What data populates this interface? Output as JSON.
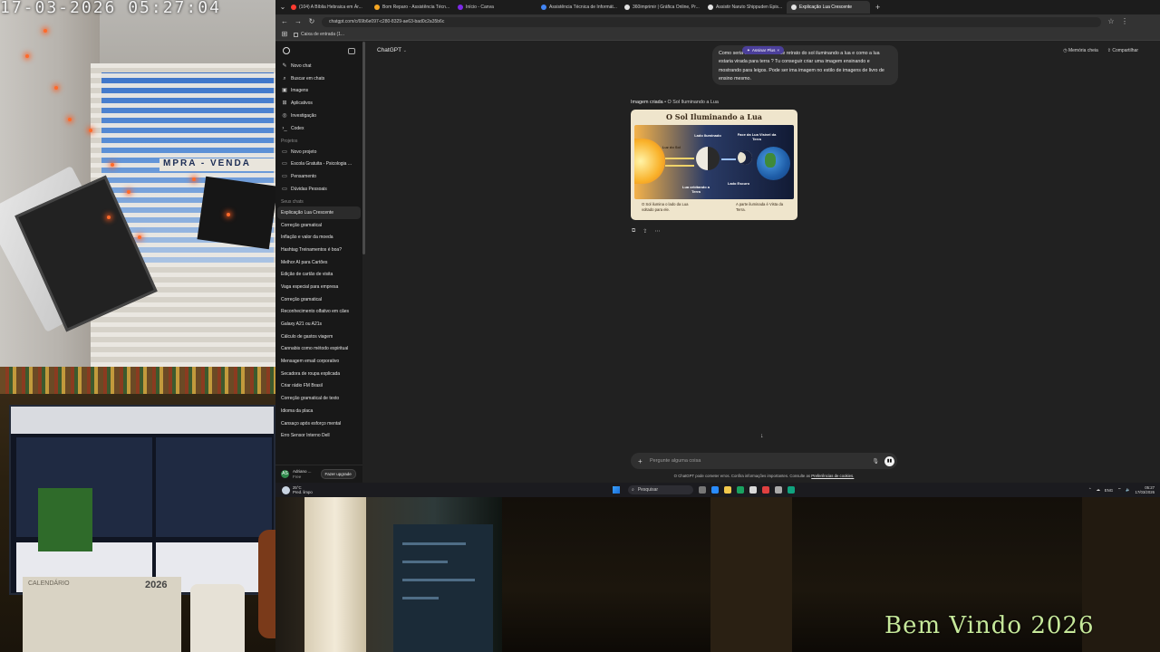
{
  "overlay": {
    "timestamp": "17-03-2026  05:27:04",
    "welcome": "Bem Vindo 2026",
    "sign_text": "MPRA - VENDA",
    "calendar_year": "2026",
    "calendar_label": "CALENDÁRIO"
  },
  "browser": {
    "tabs": [
      {
        "label": "(104) A Bíblia Hebraica em Ár...",
        "color": "#ff3b30"
      },
      {
        "label": "Bom Reparo - Assistência Técn...",
        "color": "#f5a623"
      },
      {
        "label": "Início - Canva",
        "color": "#7d2ae8"
      },
      {
        "label": "Assistência Técnica de Informát...",
        "color": "#4285f4"
      },
      {
        "label": "360imprimir | Gráfica Online, Pr...",
        "color": "#e2e2e2"
      },
      {
        "label": "Assistir Naruto Shippuden Epis...",
        "color": "#e2e2e2"
      },
      {
        "label": "Explicação Lua Crescente",
        "color": "#e2e2e2"
      }
    ],
    "url": "chatgpt.com/c/69b6e097-c280-8329-ae63-bad0c2a35b6c",
    "bookmark": "Caixa de entrada (1..."
  },
  "sidebar": {
    "nav": [
      {
        "label": "Novo chat",
        "icon": "✎"
      },
      {
        "label": "Buscar em chats",
        "icon": "⌕"
      },
      {
        "label": "Imagens",
        "icon": "▣"
      },
      {
        "label": "Aplicativos",
        "icon": "⊞"
      },
      {
        "label": "Investigação",
        "icon": "◎"
      },
      {
        "label": "Codex",
        "icon": "›_"
      }
    ],
    "projects_title": "Projetos",
    "projects": [
      {
        "label": "Novo projeto",
        "icon": "▭"
      },
      {
        "label": "Escola Gratuita - Psicologia ...",
        "icon": "▭"
      },
      {
        "label": "Pensamento",
        "icon": "▭"
      },
      {
        "label": "Dúvidas Pessoais",
        "icon": "▭"
      }
    ],
    "chats_title": "Seus chats",
    "chats": [
      "Explicação Lua Crescente",
      "Correção gramatical",
      "Inflação e valor da moeda",
      "Hashtag Treinamentos é boa?",
      "Melhor AI para Cartões",
      "Edição de cartão de visita",
      "Vaga especial para empresa",
      "Correção gramatical",
      "Reconhecimento olfativo em cães",
      "Galaxy A21 ou A21s",
      "Cálculo de gastos viagem",
      "Cannabis como método espiritual",
      "Mensagem email corporativo",
      "Secadora de roupa explicada",
      "Criar rádio FM Brasil",
      "Correção gramatical de texto",
      "Idioma da placa",
      "Cansaço após esforço mental",
      "Erro Sensor Interno Dell"
    ],
    "user": {
      "name": "Adriano ...",
      "plan": "Free",
      "initials": "AS",
      "upgrade": "Fazer upgrade"
    }
  },
  "main": {
    "model": "ChatGPT",
    "header_memory": "Memória cheia",
    "header_share": "Compartilhar",
    "plus_pill": "Assinar Plus",
    "user_message": "Como seria um desenho desse retrato do sol iluminando a lua e como a lua estaria virada para terra ? Tu conseguir criar uma imagem ensinando e mostrando para leigos. Pode ser ima imagem no estilo de imagens de livro de ensino mesmo.",
    "image_label_prefix": "Imagem criada",
    "image_label_title": "O Sol Iluminando a Lua",
    "image": {
      "title": "O Sol Iluminando a Lua",
      "label_sun": "Luz do Sol",
      "label_lit": "Lado Iluminado",
      "label_face": "Face da Lua Visível da Terra",
      "label_dark": "Lado Escuro",
      "label_orbit": "Lua orbitando a Terra",
      "caption_left": "O Sol ilumina o lado da Lua voltado para ele.",
      "caption_right": "A parte iluminada é Vista da Terra."
    },
    "composer_placeholder": "Pergunte alguma coisa",
    "disclaimer": "O ChatGPT pode cometer erros. Confira informações importantes. Consulte as",
    "disclaimer_link": "Preferências de cookies."
  },
  "taskbar": {
    "weather_temp": "25°C",
    "weather_desc": "Pred. limpo",
    "search": "Pesquisar",
    "lang": "ENG",
    "time": "05:27",
    "date": "17/03/2026"
  }
}
